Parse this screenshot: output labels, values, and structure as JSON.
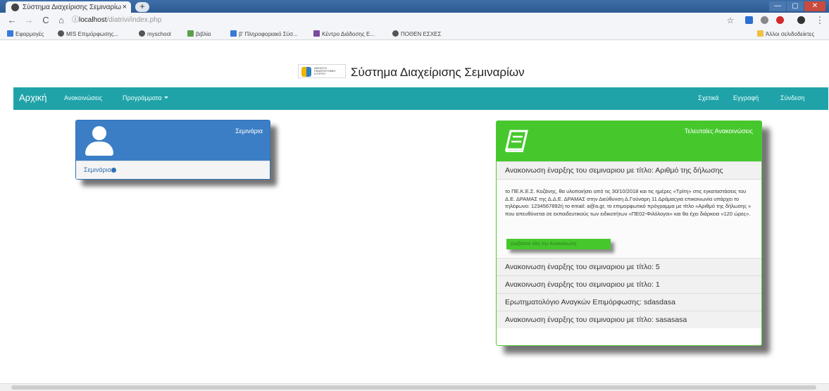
{
  "browser": {
    "tab_title": "Σύστημα Διαχείρισης Σεμιναρίω",
    "tab_close": "×",
    "new_tab": "+",
    "window_controls": [
      "—",
      "▢",
      "✕"
    ],
    "nav": {
      "back": "←",
      "forward": "→",
      "reload": "C",
      "home": "⌂",
      "info": "ⓘ"
    },
    "url_host": "localhost",
    "url_path": "/diatrivi/index.php",
    "star": "☆",
    "menu": "⋮",
    "bookmarks": [
      "Εφαρμογές",
      "MIS Επιμόρφωσης...",
      "myschool",
      "βιβλία",
      "β' Πληροφοριακό Σύσ...",
      "Κέντρο Διάδοσης Ε...",
      "ΠΟΘΕΝ ΕΣΧΕΣ"
    ],
    "other_bookmarks": "Άλλοι σελιδοδείκτες"
  },
  "site": {
    "title": "Σύστημα Διαχείρισης Σεμιναρίων",
    "logo_text": "ΑΝΟΙΧΤΟ ΠΑΝΕΠΙΣΤΗΜΙΟ ΚΥΠΡΟΥ"
  },
  "navbar": {
    "brand": "Αρχική",
    "left": [
      "Ανακοινώσεις",
      "Προγράμματα"
    ],
    "right": [
      "Σχετικά",
      "Εγγραφή",
      "Σύνδεση"
    ]
  },
  "seminars_panel": {
    "label": "Σεμινάρια",
    "link": "Σεμινάρια"
  },
  "announcements_panel": {
    "label": "Τελευταίες Ανακοινώσεις",
    "first_title": "Ανακοινωση έναρξης του σεμιναριου με τίτλο: Αριθμό της δήλωσης",
    "body": "το ΠΕ.Κ.Ε.Σ. Κοζάνης, θα υλοποιήσει από τις 30/10/2018 και τις ημέρες «Τρίτη» στις εγκαταστάσεις του Δ.Ε. ΔΡΑΜΑΣ της Δ.Δ.Ε. ΔΡΑΜΑΣ στην Διεύθυνση Δ.Γούναρη 11 Δράμαςγια επικοινωνία υπάρχει το τηλέφωνο: 1234567892ή το email: a@a.gr, το επιμορφωτικό πρόγραμμα με τίτλο «Αριθμό της δήλωσης » που απευθύνεται σε εκπαιδευτικούς των ειδικοτήτων «ΠΕ02-Φιλόλογοι» και θα έχει διάρκεια «120 ώρες».",
    "read_more": "Διαβάστε όλη την Ανακοίνωση",
    "items": [
      "Ανακοινωση έναρξης του σεμιναριου με τίτλο: 5",
      "Ανακοινωση έναρξης του σεμιναριου με τίτλο: 1",
      "Ερωτηματολόγιο Αναγκών Επιμόρφωσης: sdasdasa",
      "Ανακοινωση έναρξης του σεμιναριου με τίτλο: sasasasa"
    ]
  },
  "colors": {
    "navbar": "#20a3a8",
    "seminar_panel": "#3c7ec5",
    "announcement_panel": "#46c82d"
  }
}
